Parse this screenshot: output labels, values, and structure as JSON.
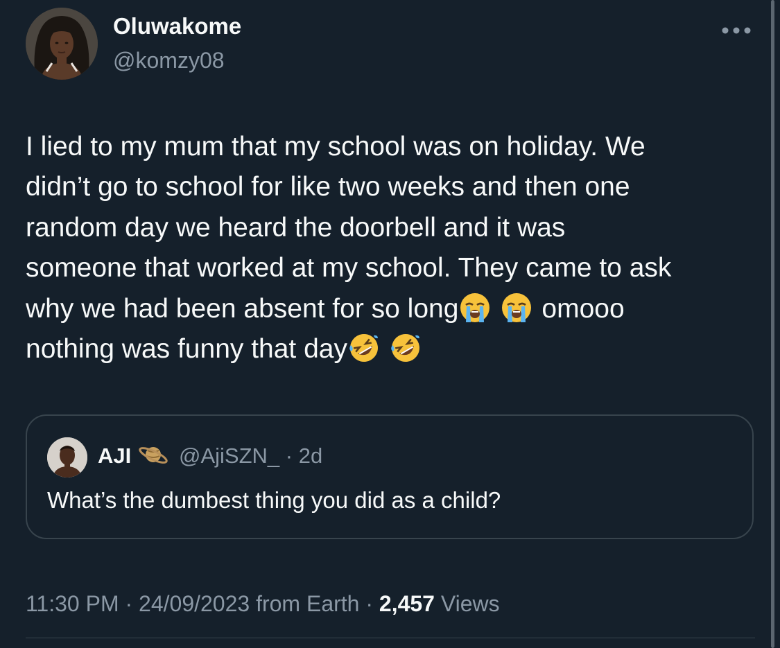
{
  "tweet": {
    "author": {
      "display_name": "Oluwakome",
      "handle": "@komzy08"
    },
    "more_icon": "more-horizontal-icon",
    "text_lines": [
      "I lied to my mum that my school was on holiday. We",
      "didn’t go to school for like two weeks and then one",
      "random day we heard the doorbell and it was",
      "someone that worked at my school. They came to ask",
      "why we had been absent for so long",
      "omooo",
      "nothing was funny that day"
    ],
    "emojis": {
      "crying": "loudly-crying-face-emoji",
      "laughing": "rolling-on-floor-laughing-emoji"
    }
  },
  "quote": {
    "display_name": "AJI",
    "badge_icon": "ringed-planet-emoji",
    "handle": "@AjiSZN_",
    "separator": "·",
    "age": "2d",
    "text": "What’s the dumbest thing you did as a child?"
  },
  "meta": {
    "time": "11:30 PM",
    "separator": "·",
    "date": "24/09/2023",
    "source": "from Earth",
    "views_count": "2,457",
    "views_label": "Views"
  },
  "colors": {
    "background": "#15202b",
    "primary_text": "#f7f9f9",
    "secondary_text": "#8b98a5",
    "border": "#38444d"
  }
}
